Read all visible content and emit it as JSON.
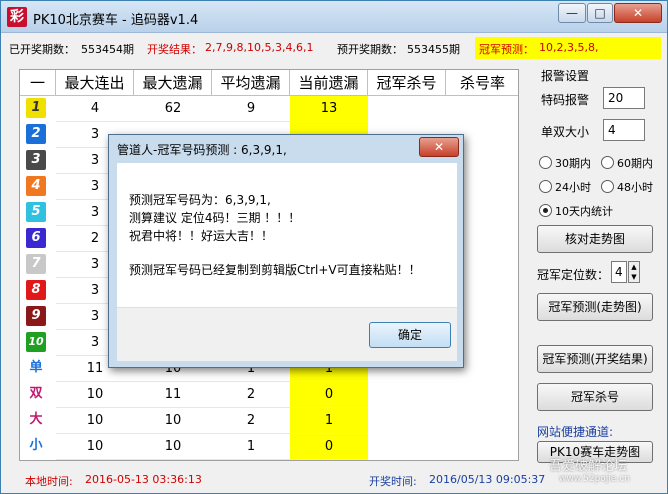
{
  "window": {
    "icon_glyph": "彩",
    "title": "PK10北京赛车 - 追码器v1.4",
    "min_glyph": "—",
    "max_glyph": "□",
    "close_glyph": "✕"
  },
  "info": {
    "opened_label": "已开奖期数：",
    "opened_value": "553454期",
    "result_label": "开奖结果：",
    "result_value": "2,7,9,8,10,5,3,4,6,1",
    "next_label": "预开奖期数：",
    "next_value": "553455期",
    "pred_label": "冠军预测：",
    "pred_value": "10,2,3,5,8,"
  },
  "table": {
    "headers": [
      "一",
      "最大连出",
      "最大遗漏",
      "平均遗漏",
      "当前遗漏",
      "冠军杀号",
      "杀号率"
    ],
    "rows": [
      {
        "badge": "1",
        "badge_color": "#f0e000",
        "badge_text": "#333333",
        "max_streak": "4",
        "max_miss": "62",
        "avg_miss": "9",
        "cur_miss": "13"
      },
      {
        "badge": "2",
        "badge_color": "#1b6fd8",
        "badge_text": "#ffffff",
        "max_streak": "3",
        "max_miss": "",
        "avg_miss": "",
        "cur_miss": ""
      },
      {
        "badge": "3",
        "badge_color": "#4a4a4a",
        "badge_text": "#ffffff",
        "max_streak": "3",
        "max_miss": "",
        "avg_miss": "",
        "cur_miss": ""
      },
      {
        "badge": "4",
        "badge_color": "#f07820",
        "badge_text": "#ffffff",
        "max_streak": "3",
        "max_miss": "",
        "avg_miss": "",
        "cur_miss": ""
      },
      {
        "badge": "5",
        "badge_color": "#30c0e0",
        "badge_text": "#ffffff",
        "max_streak": "3",
        "max_miss": "",
        "avg_miss": "",
        "cur_miss": ""
      },
      {
        "badge": "6",
        "badge_color": "#3a28d0",
        "badge_text": "#ffffff",
        "max_streak": "2",
        "max_miss": "",
        "avg_miss": "",
        "cur_miss": ""
      },
      {
        "badge": "7",
        "badge_color": "#c8c8c8",
        "badge_text": "#ffffff",
        "max_streak": "3",
        "max_miss": "",
        "avg_miss": "",
        "cur_miss": ""
      },
      {
        "badge": "8",
        "badge_color": "#e01818",
        "badge_text": "#ffffff",
        "max_streak": "3",
        "max_miss": "",
        "avg_miss": "",
        "cur_miss": ""
      },
      {
        "badge": "9",
        "badge_color": "#8a1818",
        "badge_text": "#ffffff",
        "max_streak": "3",
        "max_miss": "",
        "avg_miss": "",
        "cur_miss": ""
      },
      {
        "badge": "10",
        "badge_color": "#20a020",
        "badge_text": "#ffffff",
        "max_streak": "3",
        "max_miss": "",
        "avg_miss": "",
        "cur_miss": ""
      },
      {
        "badge": "单",
        "badge_color": "",
        "badge_text": "#1b6fd8",
        "max_streak": "11",
        "max_miss": "10",
        "avg_miss": "1",
        "cur_miss": "1"
      },
      {
        "badge": "双",
        "badge_color": "",
        "badge_text": "#c01870",
        "max_streak": "10",
        "max_miss": "11",
        "avg_miss": "2",
        "cur_miss": "0"
      },
      {
        "badge": "大",
        "badge_color": "",
        "badge_text": "#c01870",
        "max_streak": "10",
        "max_miss": "10",
        "avg_miss": "2",
        "cur_miss": "1"
      },
      {
        "badge": "小",
        "badge_color": "",
        "badge_text": "#1b6fd8",
        "max_streak": "10",
        "max_miss": "10",
        "avg_miss": "1",
        "cur_miss": "0"
      }
    ]
  },
  "panel": {
    "alarm_title": "报警设置",
    "special_label": "特码报警",
    "special_value": "20",
    "oddeven_label": "单双大小",
    "oddeven_value": "4",
    "radios": [
      {
        "label": "30期内",
        "checked": false
      },
      {
        "label": "60期内",
        "checked": false
      },
      {
        "label": "24小时",
        "checked": false
      },
      {
        "label": "48小时",
        "checked": false
      },
      {
        "label": "10天内统计",
        "checked": true
      }
    ],
    "check_trend_btn": "核对走势图",
    "champion_pos_label": "冠军定位数：",
    "champion_pos_value": "4",
    "spin_up": "▲",
    "spin_down": "▼",
    "pred_trend_btn": "冠军预测(走势图)",
    "pred_result_btn": "冠军预测(开奖结果)",
    "kill_btn": "冠军杀号",
    "site_label": "网站便捷通道:",
    "site_btn": "PK10赛车走势图"
  },
  "status": {
    "local_label": "本地时间:",
    "local_value": "2016-05-13 03:36:13",
    "draw_label": "开奖时间:",
    "draw_value": "2016/05/13 09:05:37"
  },
  "dialog": {
    "title": "管道人-冠军号码预测 : 6,3,9,1,",
    "close_glyph": "✕",
    "lines": [
      "预测冠军号码为：6,3,9,1,",
      "测算建议 定位4码！三期 ！！！",
      "祝君中将！！好运大吉！！",
      "预测冠军号码已经复制到剪辑版Ctrl+V可直接粘贴！！"
    ],
    "ok_label": "确定"
  },
  "watermark": {
    "line1": "吾爱破解论坛",
    "line2": "www.52pojie.cn"
  }
}
